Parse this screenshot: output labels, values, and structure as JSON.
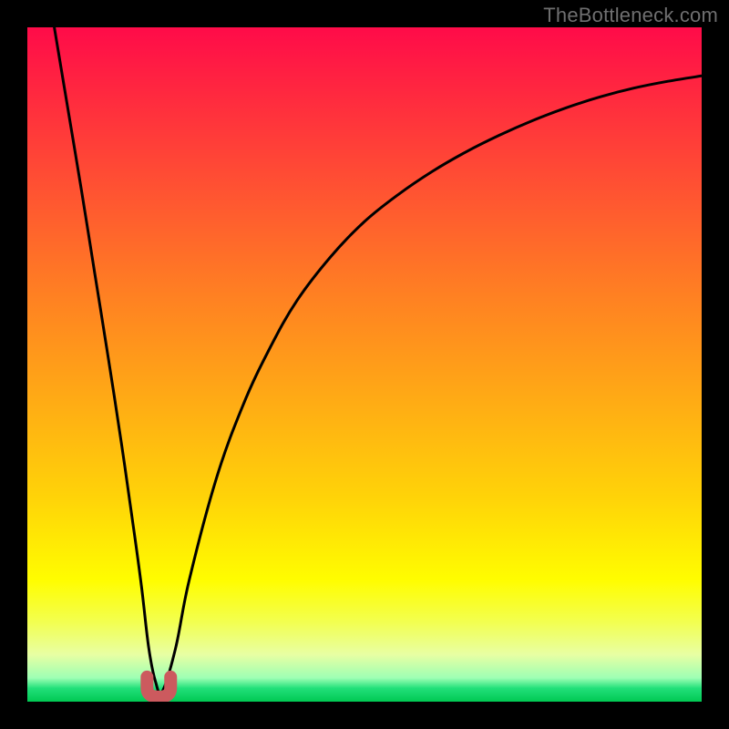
{
  "watermark": "TheBottleneck.com",
  "colors": {
    "background": "#000000",
    "curve": "#000000",
    "minimum_marker": "#cc5a5e"
  },
  "chart_data": {
    "type": "line",
    "title": "",
    "xlabel": "",
    "ylabel": "",
    "xlim": [
      0,
      100
    ],
    "ylim": [
      0,
      100
    ],
    "x": [
      4.0,
      6.0,
      8.0,
      10.0,
      12.0,
      14.0,
      16.0,
      17.0,
      18.0,
      19.0,
      20.0,
      22.0,
      24.0,
      28.0,
      32.0,
      36.0,
      40.0,
      45.0,
      50.0,
      55.0,
      60.0,
      65.0,
      70.0,
      75.0,
      80.0,
      85.0,
      90.0,
      95.0,
      100.0
    ],
    "values": [
      100.0,
      88.0,
      76.0,
      63.5,
      51.0,
      38.0,
      24.0,
      16.5,
      8.0,
      3.0,
      1.5,
      8.0,
      18.0,
      33.0,
      44.0,
      52.5,
      59.5,
      66.0,
      71.2,
      75.2,
      78.6,
      81.5,
      84.0,
      86.2,
      88.1,
      89.7,
      91.0,
      92.0,
      92.8
    ],
    "minimum_marker": {
      "x": 19.5,
      "value": 1.5,
      "width": 3.5
    },
    "background_gradient": {
      "orientation": "vertical",
      "stops": [
        {
          "pos": 0.0,
          "color": "#ff0b49"
        },
        {
          "pos": 0.12,
          "color": "#ff2f3d"
        },
        {
          "pos": 0.26,
          "color": "#ff5830"
        },
        {
          "pos": 0.4,
          "color": "#ff8122"
        },
        {
          "pos": 0.55,
          "color": "#ffaa15"
        },
        {
          "pos": 0.7,
          "color": "#ffd408"
        },
        {
          "pos": 0.82,
          "color": "#fffd00"
        },
        {
          "pos": 0.88,
          "color": "#f3ff4d"
        },
        {
          "pos": 0.93,
          "color": "#e8ffa3"
        },
        {
          "pos": 0.965,
          "color": "#9dffb4"
        },
        {
          "pos": 0.98,
          "color": "#22e07a"
        },
        {
          "pos": 1.0,
          "color": "#00c853"
        }
      ]
    }
  }
}
